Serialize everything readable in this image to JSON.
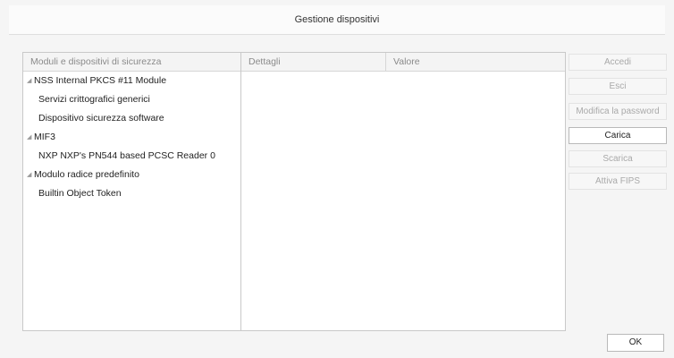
{
  "window": {
    "title": "Gestione dispositivi"
  },
  "tree": {
    "header": "Moduli e dispositivi di sicurezza",
    "collapse_glyph": "◢",
    "items": [
      {
        "kind": "module",
        "label": "NSS Internal PKCS #11 Module"
      },
      {
        "kind": "device",
        "label": "Servizi crittografici generici"
      },
      {
        "kind": "device",
        "label": "Dispositivo sicurezza software"
      },
      {
        "kind": "module",
        "label": "MIF3"
      },
      {
        "kind": "device",
        "label": "NXP NXP's PN544 based PCSC Reader 0"
      },
      {
        "kind": "module",
        "label": "Modulo radice predefinito"
      },
      {
        "kind": "device",
        "label": "Builtin Object Token"
      }
    ]
  },
  "details": {
    "col_dettagli": "Dettagli",
    "col_valore": "Valore"
  },
  "buttons": {
    "accedi": "Accedi",
    "esci": "Esci",
    "modifica_password": "Modifica la password",
    "carica": "Carica",
    "scarica": "Scarica",
    "attiva_fips": "Attiva FIPS"
  },
  "ok_button": "OK"
}
